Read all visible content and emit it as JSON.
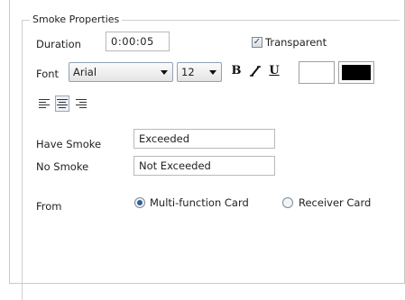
{
  "group": {
    "title": "Smoke Properties"
  },
  "duration": {
    "label": "Duration",
    "value": "0:00:05"
  },
  "transparent": {
    "label": "Transparent",
    "checked": true
  },
  "font": {
    "label": "Font",
    "family": "Arial",
    "size": "12",
    "bold_icon": "bold-icon",
    "italic_icon": "italic-icon",
    "underline_icon": "underline-icon",
    "background_color": "#ffffff",
    "foreground_color": "#000000"
  },
  "alignment": {
    "options": [
      "align-left-icon",
      "align-center-icon",
      "align-right-icon"
    ],
    "selected": "align-center-icon"
  },
  "have_smoke": {
    "label": "Have Smoke",
    "value": "Exceeded"
  },
  "no_smoke": {
    "label": "No Smoke",
    "value": "Not Exceeded"
  },
  "from": {
    "label": "From",
    "options": [
      {
        "label": "Multi-function Card",
        "selected": true
      },
      {
        "label": "Receiver Card",
        "selected": false
      }
    ]
  }
}
